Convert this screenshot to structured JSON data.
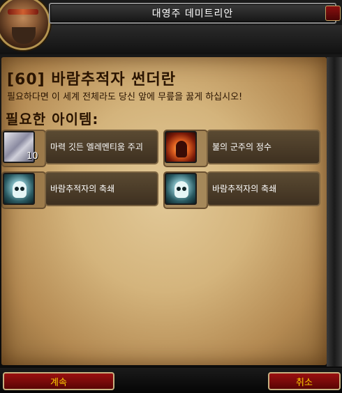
{
  "window": {
    "title": "대영주 데미트리안"
  },
  "quest": {
    "title": "[60] 바람추적자 썬더란",
    "description": "필요하다면 이 세계 전체라도 당신 앞에 무릎을 꿇게 하십시오!",
    "required_heading": "필요한 아이템:"
  },
  "items": [
    {
      "label": "마력 깃든 엘레멘티움 주괴",
      "count": "10",
      "icon": "elementium-bar-icon"
    },
    {
      "label": "불의 군주의 정수",
      "count": "",
      "icon": "fire-lord-essence-icon"
    },
    {
      "label": "바람추적자의 축쇄",
      "count": "",
      "icon": "skull-binding-icon"
    },
    {
      "label": "바람추적자의 축쇄",
      "count": "",
      "icon": "skull-binding-icon"
    }
  ],
  "buttons": {
    "continue": "계속",
    "cancel": "취소"
  },
  "colors": {
    "accent": "#ffd100",
    "button": "#8b0a0a",
    "text_dark": "#2a1400"
  }
}
